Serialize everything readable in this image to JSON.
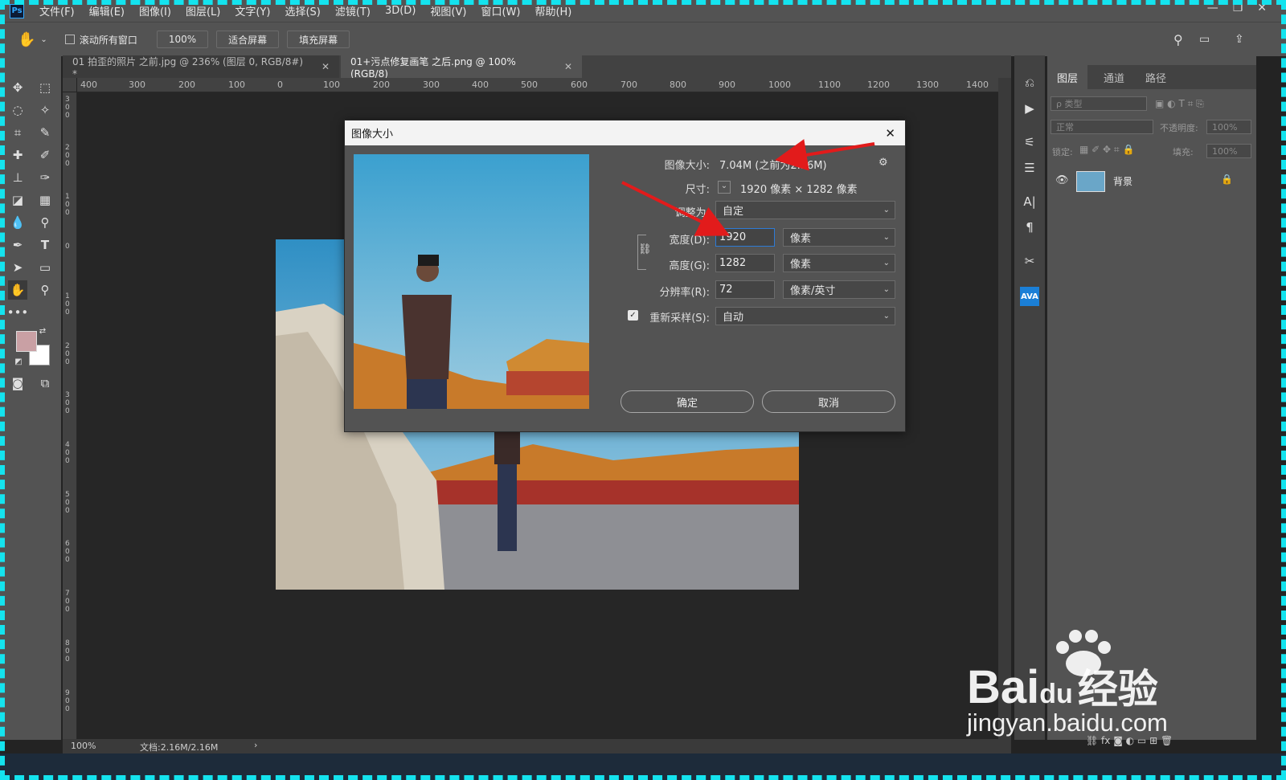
{
  "menubar": {
    "logo": "Ps",
    "items": [
      "文件(F)",
      "编辑(E)",
      "图像(I)",
      "图层(L)",
      "文字(Y)",
      "选择(S)",
      "滤镜(T)",
      "3D(D)",
      "视图(V)",
      "窗口(W)",
      "帮助(H)"
    ],
    "window_controls": [
      "—",
      "❐",
      "✕"
    ]
  },
  "options": {
    "scroll_all_label": "滚动所有窗口",
    "zoom_btn": "100%",
    "fit_btn": "适合屏幕",
    "fill_btn": "填充屏幕"
  },
  "tabs": [
    {
      "label": "01 拍歪的照片 之前.jpg @ 236% (图层 0, RGB/8#) *",
      "close": "✕"
    },
    {
      "label": "01+污点修复画笔 之后.png @ 100%(RGB/8)",
      "close": "✕"
    }
  ],
  "ruler": {
    "h": [
      "400",
      "300",
      "200",
      "100",
      "0",
      "100",
      "200",
      "300",
      "400",
      "500",
      "600",
      "700",
      "800",
      "900",
      "1000",
      "1100",
      "1200",
      "1300",
      "1400"
    ],
    "v": [
      "300",
      "200",
      "100",
      "0",
      "100",
      "200",
      "300",
      "400",
      "500",
      "600",
      "700",
      "800",
      "900"
    ]
  },
  "status": {
    "zoom": "100%",
    "doc": "文档:2.16M/2.16M",
    "arrow": "›"
  },
  "panel": {
    "tabs": [
      "图层",
      "通道",
      "路径"
    ],
    "kind_placeholder": "ρ 类型",
    "blend_mode": "正常",
    "opacity_label": "不透明度:",
    "opacity_value": "100%",
    "lock_label": "锁定:",
    "fill_label": "填充:",
    "fill_value": "100%",
    "layer_name": "背景"
  },
  "dialog": {
    "title": "图像大小",
    "close": "✕",
    "size_label": "图像大小:",
    "size_value": "7.04M (之前为2.16M)",
    "dim_label": "尺寸:",
    "dim_value": "1920 像素  ×  1282 像素",
    "fit_label": "调整为:",
    "fit_value": "自定",
    "width_label": "宽度(D):",
    "width_value": "1920",
    "width_unit": "像素",
    "height_label": "高度(G):",
    "height_value": "1282",
    "height_unit": "像素",
    "res_label": "分辨率(R):",
    "res_value": "72",
    "res_unit": "像素/英寸",
    "resample_label": "重新采样(S):",
    "resample_checked": true,
    "resample_value": "自动",
    "ok": "确定",
    "cancel": "取消"
  },
  "watermark": {
    "brand_a": "Bai",
    "brand_b": "du",
    "brand_c": "经验",
    "url": "jingyan.baidu.com"
  },
  "colors": {
    "foreground": "#c9a0a4",
    "background": "#ffffff",
    "accent": "#31a8ff",
    "arrow": "#e21b1b",
    "frame": "#14e3ee"
  }
}
